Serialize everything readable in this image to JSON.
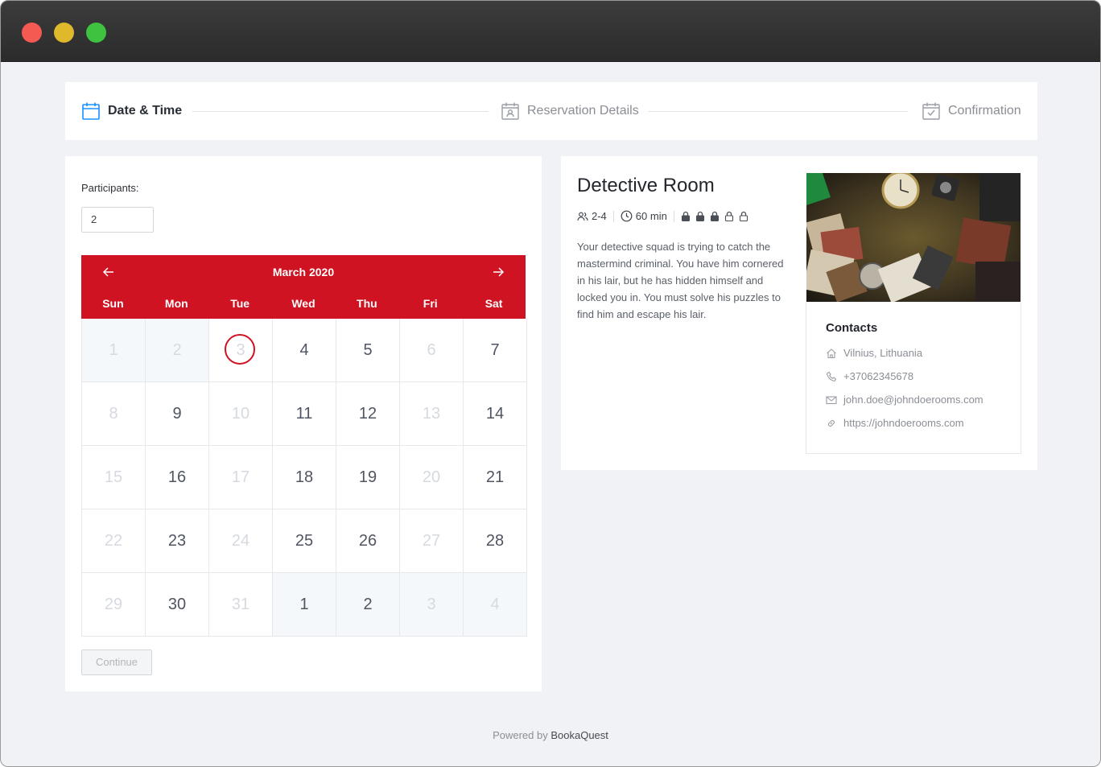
{
  "window": {
    "controls": [
      "close",
      "minimize",
      "maximize"
    ]
  },
  "steps": [
    {
      "label": "Date & Time",
      "icon": "calendar-icon",
      "active": true
    },
    {
      "label": "Reservation Details",
      "icon": "calendar-user-icon",
      "active": false
    },
    {
      "label": "Confirmation",
      "icon": "calendar-check-icon",
      "active": false
    }
  ],
  "booking": {
    "participants_label": "Participants:",
    "participants_value": "2",
    "continue_label": "Continue"
  },
  "calendar": {
    "month": "March 2020",
    "weekdays": [
      "Sun",
      "Mon",
      "Tue",
      "Wed",
      "Thu",
      "Fri",
      "Sat"
    ],
    "accent": "#cf1322",
    "weeks": [
      [
        {
          "d": "1",
          "off": true,
          "shade": true
        },
        {
          "d": "2",
          "off": true,
          "shade": true
        },
        {
          "d": "3",
          "off": true,
          "today": true
        },
        {
          "d": "4"
        },
        {
          "d": "5"
        },
        {
          "d": "6",
          "off": true
        },
        {
          "d": "7"
        }
      ],
      [
        {
          "d": "8",
          "off": true
        },
        {
          "d": "9"
        },
        {
          "d": "10",
          "off": true
        },
        {
          "d": "11"
        },
        {
          "d": "12"
        },
        {
          "d": "13",
          "off": true
        },
        {
          "d": "14"
        }
      ],
      [
        {
          "d": "15",
          "off": true
        },
        {
          "d": "16"
        },
        {
          "d": "17",
          "off": true
        },
        {
          "d": "18"
        },
        {
          "d": "19"
        },
        {
          "d": "20",
          "off": true
        },
        {
          "d": "21"
        }
      ],
      [
        {
          "d": "22",
          "off": true
        },
        {
          "d": "23"
        },
        {
          "d": "24",
          "off": true
        },
        {
          "d": "25"
        },
        {
          "d": "26"
        },
        {
          "d": "27",
          "off": true
        },
        {
          "d": "28"
        }
      ],
      [
        {
          "d": "29",
          "off": true
        },
        {
          "d": "30"
        },
        {
          "d": "31",
          "off": true
        },
        {
          "d": "1",
          "shade": true
        },
        {
          "d": "2",
          "shade": true
        },
        {
          "d": "3",
          "off": true,
          "shade": true
        },
        {
          "d": "4",
          "off": true,
          "shade": true
        }
      ]
    ]
  },
  "room": {
    "title": "Detective Room",
    "players": "2-4",
    "duration": "60 min",
    "difficulty": 3,
    "difficulty_max": 5,
    "description": "Your detective squad is trying to catch the mastermind criminal. You have him cornered in his lair, but he has hidden himself and locked you in. You must solve his puzzles to find him and escape his lair."
  },
  "contacts": {
    "title": "Contacts",
    "address": "Vilnius, Lithuania",
    "phone": "+37062345678",
    "email": "john.doe@johndoerooms.com",
    "website": "https://johndoerooms.com"
  },
  "footer": {
    "prefix": "Powered by",
    "brand": "BookaQuest"
  }
}
